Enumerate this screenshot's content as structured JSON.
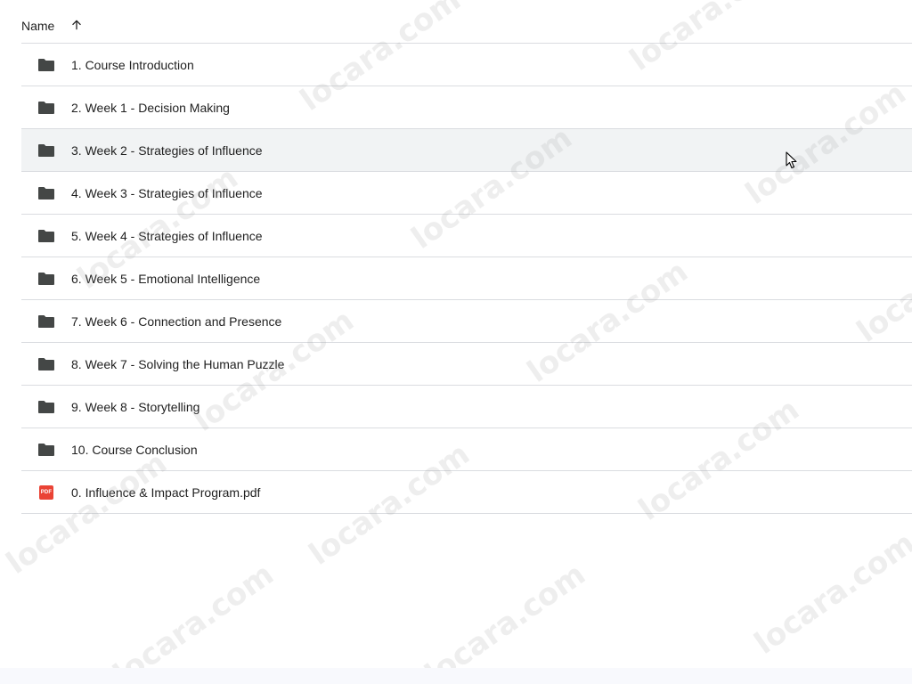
{
  "header": {
    "name_label": "Name",
    "sort_direction": "ascending"
  },
  "files": [
    {
      "name": "1. Course Introduction",
      "type": "folder"
    },
    {
      "name": "2. Week 1 - Decision Making",
      "type": "folder"
    },
    {
      "name": "3. Week 2 - Strategies of Influence",
      "type": "folder",
      "hovered": true
    },
    {
      "name": "4. Week 3 - Strategies of Influence",
      "type": "folder"
    },
    {
      "name": "5. Week 4 - Strategies of Influence",
      "type": "folder"
    },
    {
      "name": "6. Week 5 - Emotional Intelligence",
      "type": "folder"
    },
    {
      "name": "7. Week 6 - Connection and Presence",
      "type": "folder"
    },
    {
      "name": "8. Week 7 - Solving the Human Puzzle",
      "type": "folder"
    },
    {
      "name": "9. Week 8 - Storytelling",
      "type": "folder"
    },
    {
      "name": "10. Course Conclusion",
      "type": "folder"
    },
    {
      "name": "0. Influence & Impact Program.pdf",
      "type": "pdf"
    }
  ],
  "pdf_badge_text": "PDF",
  "watermark_text": "locara.com",
  "icons": {
    "folder": "folder-icon",
    "pdf": "pdf-icon",
    "sort": "arrow-up-icon",
    "cursor": "mouse-pointer-icon"
  },
  "colors": {
    "folder": "#444746",
    "pdf": "#ea4335",
    "divider": "#dadce0",
    "hover": "#f1f3f4"
  }
}
